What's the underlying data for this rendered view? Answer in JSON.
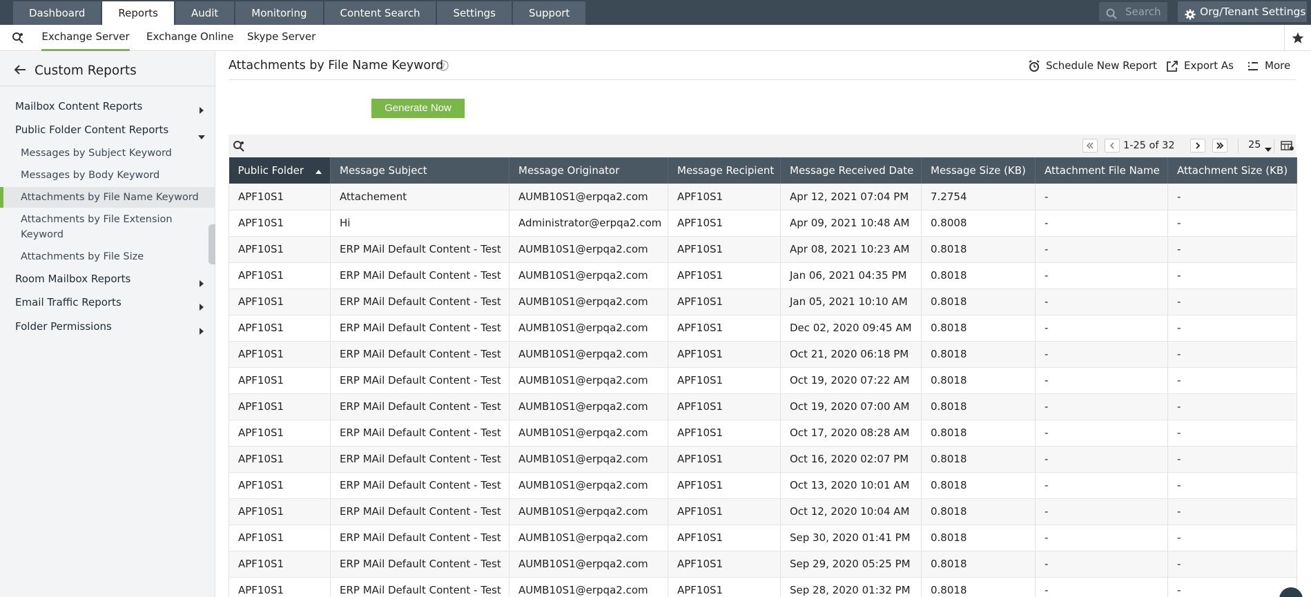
{
  "topnav": {
    "tabs": [
      {
        "label": "Dashboard",
        "active": false
      },
      {
        "label": "Reports",
        "active": true
      },
      {
        "label": "Audit",
        "active": false
      },
      {
        "label": "Monitoring",
        "active": false
      },
      {
        "label": "Content Search",
        "active": false
      },
      {
        "label": "Settings",
        "active": false
      },
      {
        "label": "Support",
        "active": false
      }
    ],
    "search_placeholder": "Search",
    "org_button": "Org/Tenant Settings"
  },
  "subnav": {
    "tabs": [
      "Exchange Server",
      "Exchange Online",
      "Skype Server"
    ],
    "active": "Exchange Server"
  },
  "sidebar": {
    "title": "Custom Reports",
    "groups": [
      {
        "label": "Mailbox Content Reports",
        "expanded": false
      },
      {
        "label": "Public Folder Content Reports",
        "expanded": true
      },
      {
        "label": "Room Mailbox Reports",
        "expanded": false
      },
      {
        "label": "Email Traffic Reports",
        "expanded": false
      },
      {
        "label": "Folder Permissions",
        "expanded": false
      }
    ],
    "items": [
      {
        "label": "Messages by Subject Keyword"
      },
      {
        "label": "Messages by Body Keyword"
      },
      {
        "label": "Attachments by File Name Keyword",
        "active": true
      },
      {
        "label": "Attachments by File Extension",
        "label2": "Keyword"
      },
      {
        "label": "Attachments by File Size"
      }
    ]
  },
  "main": {
    "title": "Attachments by File Name Keyword",
    "actions": {
      "schedule": "Schedule New Report",
      "export": "Export As",
      "more": "More"
    },
    "generate_button": "Generate Now",
    "pagination": {
      "info": "1-25 of 32",
      "page_size": "25"
    }
  },
  "table": {
    "columns": [
      "Public Folder",
      "Message Subject",
      "Message Originator",
      "Message Recipient",
      "Message Received Date",
      "Message Size (KB)",
      "Attachment File Name",
      "Attachment Size (KB)"
    ],
    "sort_column": "Public Folder",
    "rows": [
      [
        "APF10S1",
        "Attachement",
        "AUMB10S1@erpqa2.com",
        "APF10S1",
        "Apr 12, 2021 07:04 PM",
        "7.2754",
        "-",
        "-"
      ],
      [
        "APF10S1",
        "Hi",
        "Administrator@erpqa2.com",
        "APF10S1",
        "Apr 09, 2021 10:48 AM",
        "0.8008",
        "-",
        "-"
      ],
      [
        "APF10S1",
        "ERP MAil Default Content - Test",
        "AUMB10S1@erpqa2.com",
        "APF10S1",
        "Apr 08, 2021 10:23 AM",
        "0.8018",
        "-",
        "-"
      ],
      [
        "APF10S1",
        "ERP MAil Default Content - Test",
        "AUMB10S1@erpqa2.com",
        "APF10S1",
        "Jan 06, 2021 04:35 PM",
        "0.8018",
        "-",
        "-"
      ],
      [
        "APF10S1",
        "ERP MAil Default Content - Test",
        "AUMB10S1@erpqa2.com",
        "APF10S1",
        "Jan 05, 2021 10:10 AM",
        "0.8018",
        "-",
        "-"
      ],
      [
        "APF10S1",
        "ERP MAil Default Content - Test",
        "AUMB10S1@erpqa2.com",
        "APF10S1",
        "Dec 02, 2020 09:45 AM",
        "0.8018",
        "-",
        "-"
      ],
      [
        "APF10S1",
        "ERP MAil Default Content - Test",
        "AUMB10S1@erpqa2.com",
        "APF10S1",
        "Oct 21, 2020 06:18 PM",
        "0.8018",
        "-",
        "-"
      ],
      [
        "APF10S1",
        "ERP MAil Default Content - Test",
        "AUMB10S1@erpqa2.com",
        "APF10S1",
        "Oct 19, 2020 07:22 AM",
        "0.8018",
        "-",
        "-"
      ],
      [
        "APF10S1",
        "ERP MAil Default Content - Test",
        "AUMB10S1@erpqa2.com",
        "APF10S1",
        "Oct 19, 2020 07:00 AM",
        "0.8018",
        "-",
        "-"
      ],
      [
        "APF10S1",
        "ERP MAil Default Content - Test",
        "AUMB10S1@erpqa2.com",
        "APF10S1",
        "Oct 17, 2020 08:28 AM",
        "0.8018",
        "-",
        "-"
      ],
      [
        "APF10S1",
        "ERP MAil Default Content - Test",
        "AUMB10S1@erpqa2.com",
        "APF10S1",
        "Oct 16, 2020 02:07 PM",
        "0.8018",
        "-",
        "-"
      ],
      [
        "APF10S1",
        "ERP MAil Default Content - Test",
        "AUMB10S1@erpqa2.com",
        "APF10S1",
        "Oct 13, 2020 10:01 AM",
        "0.8018",
        "-",
        "-"
      ],
      [
        "APF10S1",
        "ERP MAil Default Content - Test",
        "AUMB10S1@erpqa2.com",
        "APF10S1",
        "Oct 12, 2020 10:04 AM",
        "0.8018",
        "-",
        "-"
      ],
      [
        "APF10S1",
        "ERP MAil Default Content - Test",
        "AUMB10S1@erpqa2.com",
        "APF10S1",
        "Sep 30, 2020 01:41 PM",
        "0.8018",
        "-",
        "-"
      ],
      [
        "APF10S1",
        "ERP MAil Default Content - Test",
        "AUMB10S1@erpqa2.com",
        "APF10S1",
        "Sep 29, 2020 05:25 PM",
        "0.8018",
        "-",
        "-"
      ],
      [
        "APF10S1",
        "ERP MAil Default Content - Test",
        "AUMB10S1@erpqa2.com",
        "APF10S1",
        "Sep 28, 2020 01:32 PM",
        "0.8018",
        "-",
        "-"
      ]
    ]
  }
}
